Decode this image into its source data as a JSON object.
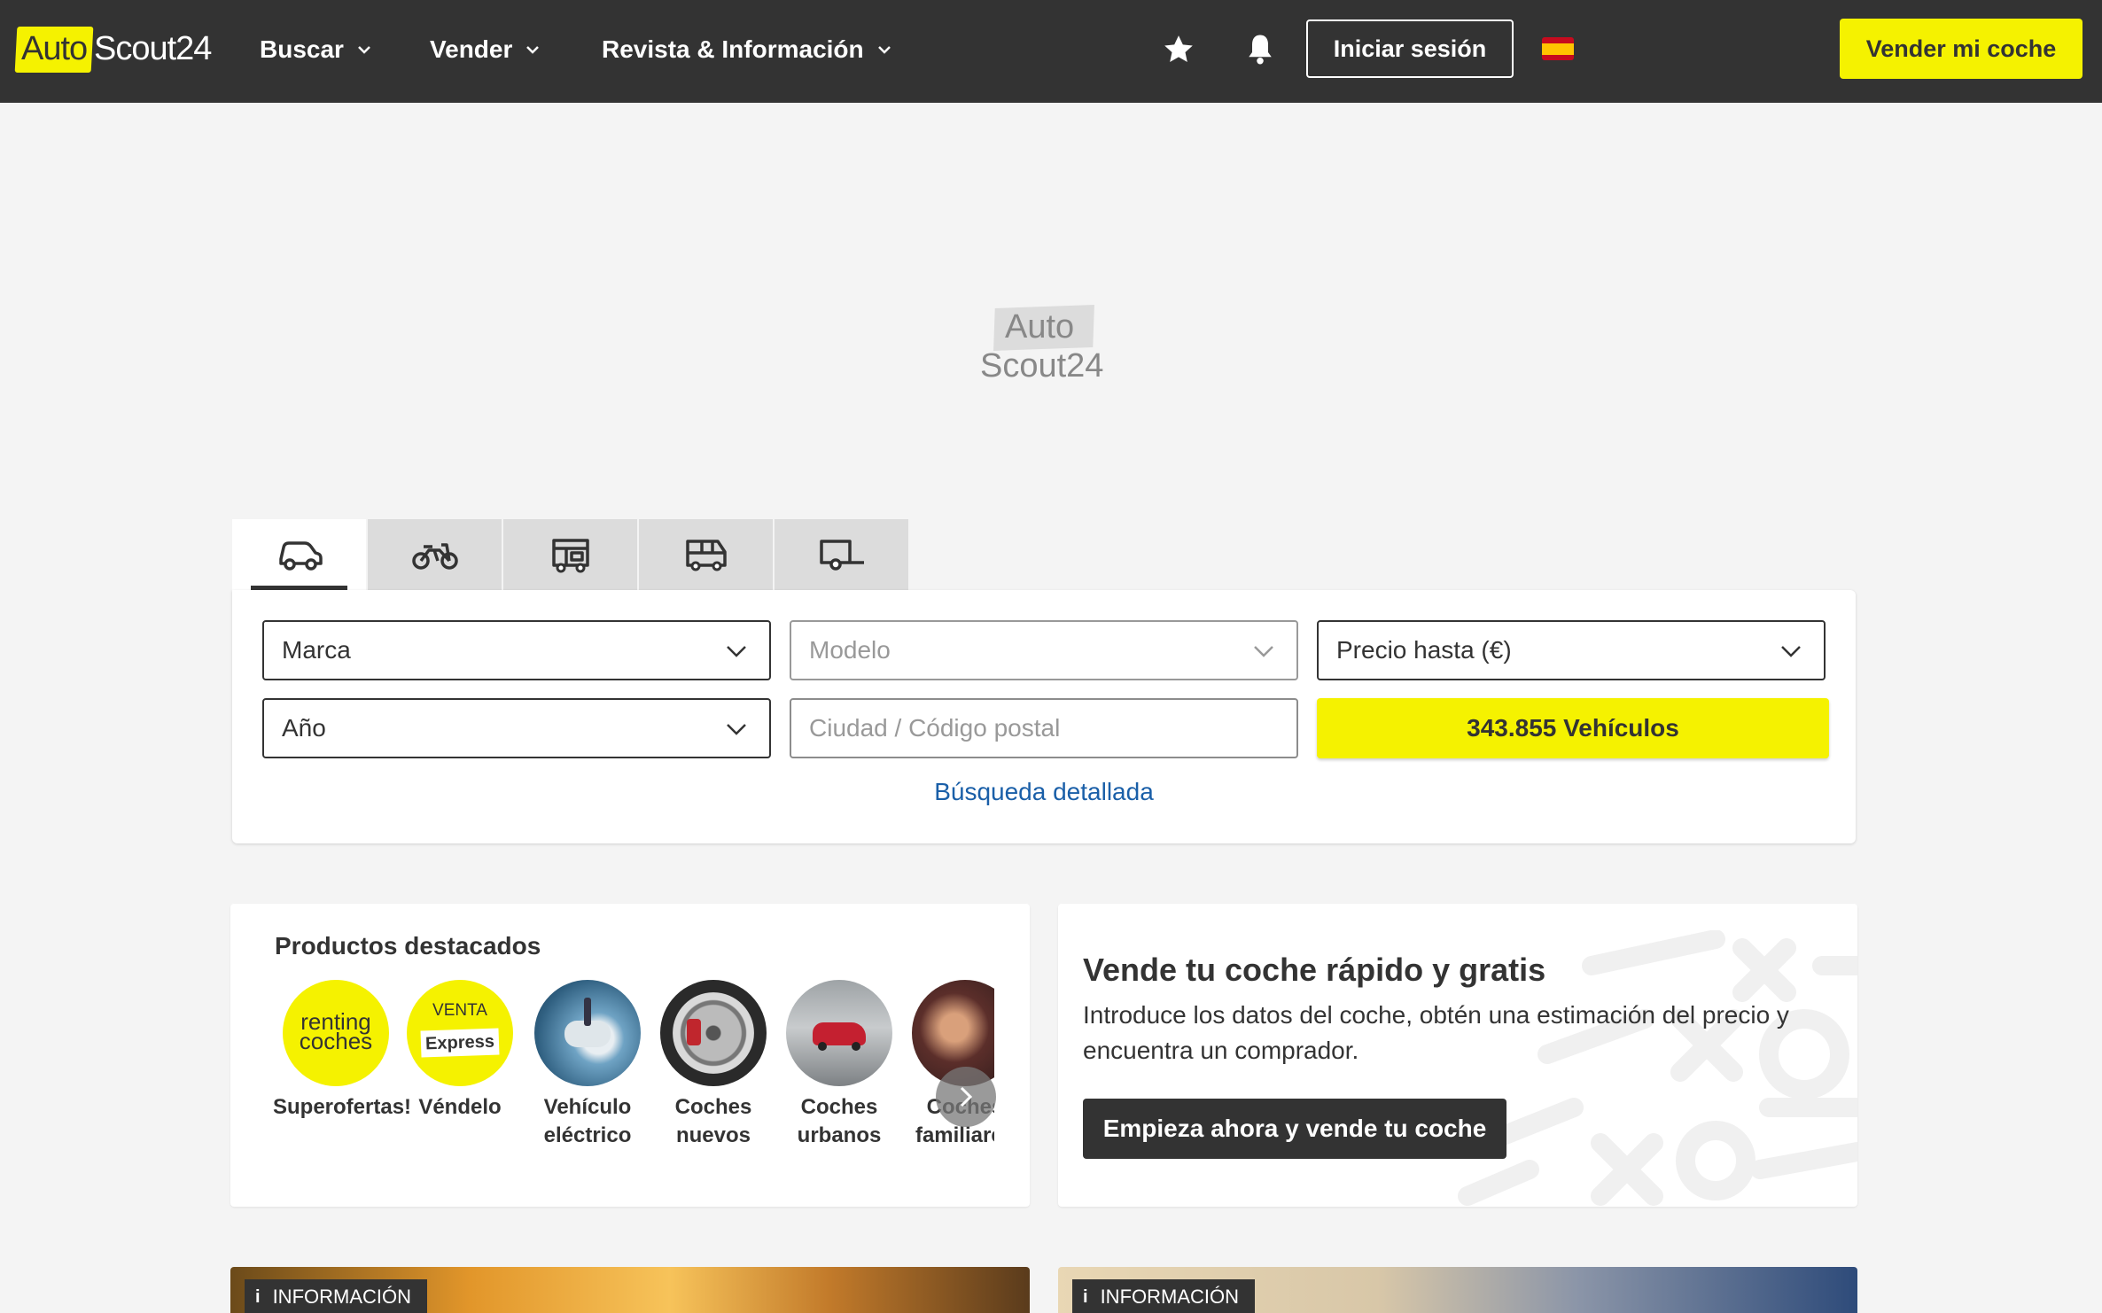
{
  "header": {
    "logo": {
      "auto": "Auto",
      "scout": "Scout24"
    },
    "nav": [
      {
        "label": "Buscar"
      },
      {
        "label": "Vender"
      },
      {
        "label": "Revista & Información"
      }
    ],
    "favorites_icon": "star-icon",
    "notifications_icon": "bell-icon",
    "login_label": "Iniciar sesión",
    "language_flag": "spain-flag-icon",
    "sell_car_label": "Vender mi coche"
  },
  "ad_placeholder": {
    "line1": "Auto",
    "line2": "Scout24"
  },
  "search": {
    "tabs": [
      {
        "icon": "car-icon",
        "active": true
      },
      {
        "icon": "motorbike-icon",
        "active": false
      },
      {
        "icon": "camper-icon",
        "active": false
      },
      {
        "icon": "van-icon",
        "active": false
      },
      {
        "icon": "trailer-icon",
        "active": false
      }
    ],
    "make_label": "Marca",
    "model_label": "Modelo",
    "price_label": "Precio hasta (€)",
    "year_label": "Año",
    "location_placeholder": "Ciudad / Código postal",
    "results_button": "343.855 Vehículos",
    "detailed_search": "Búsqueda detallada"
  },
  "featured": {
    "title": "Productos destacados",
    "items": [
      {
        "label": "Superofertas!",
        "badge_line1": "renting",
        "badge_line2": "coches"
      },
      {
        "label": "Véndelo",
        "badge_line1": "VENTA",
        "badge_line2": "Express"
      },
      {
        "label": "Vehículo eléctrico"
      },
      {
        "label": "Coches nuevos"
      },
      {
        "label": "Coches urbanos"
      },
      {
        "label": "Coches familiares"
      }
    ]
  },
  "sell_promo": {
    "title": "Vende tu coche rápido y gratis",
    "description": "Introduce los datos del coche, obtén una estimación del precio y encuentra un comprador.",
    "cta": "Empieza ahora y vende tu coche"
  },
  "teasers": [
    {
      "badge": "INFORMACIÓN"
    },
    {
      "badge": "INFORMACIÓN"
    }
  ],
  "colors": {
    "header_bg": "#333333",
    "brand_yellow": "#f5f200",
    "link_blue": "#1a5fa8",
    "page_bg": "#f4f4f4"
  }
}
